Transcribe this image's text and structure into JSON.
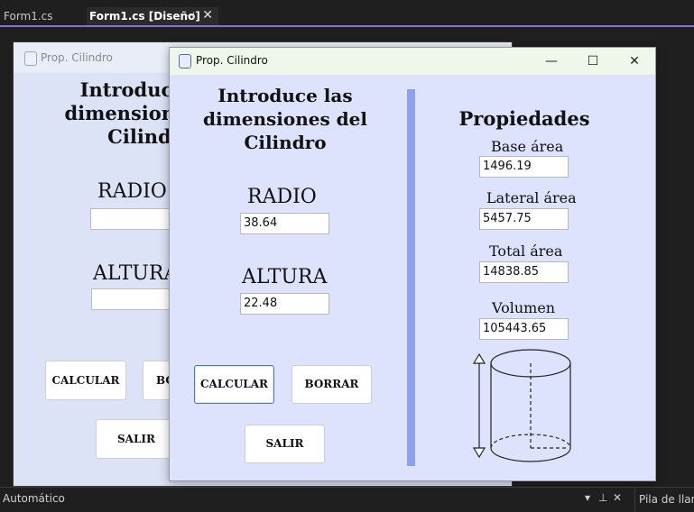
{
  "ide": {
    "tabs": [
      {
        "label": "Form1.cs"
      },
      {
        "label": "Form1.cs [Diseño]"
      }
    ],
    "bottom": {
      "automatico": "Automático",
      "pila": "Pila de llam"
    }
  },
  "designer_form": {
    "title": "Prop. Cilindro",
    "intro": "Introduce las dimensiones del Cilindro",
    "radio_label": "RADIO",
    "altura_label": "ALTURA",
    "btn_calcular": "CALCULAR",
    "btn_borrar": "BORRAR",
    "btn_salir": "SALIR"
  },
  "app": {
    "title": "Prop. Cilindro",
    "intro": "Introduce las dimensiones del Cilindro",
    "radio_label": "RADIO",
    "radio_value": "38.64",
    "altura_label": "ALTURA",
    "altura_value": "22.48",
    "btn_calcular": "CALCULAR",
    "btn_borrar": "BORRAR",
    "btn_salir": "SALIR",
    "properties_title": "Propiedades",
    "base_label": "Base área",
    "base_value": "1496.19",
    "lateral_label": "Lateral área",
    "lateral_value": "5457.75",
    "total_label": "Total área",
    "total_value": "14838.85",
    "volumen_label": "Volumen",
    "volumen_value": "105443.65"
  },
  "colors": {
    "accent": "#8a6bd8",
    "form_bg": "#dde3fc",
    "divider": "#8aa0f0"
  }
}
